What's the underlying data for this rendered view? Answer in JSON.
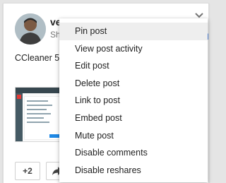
{
  "post": {
    "author": "ve",
    "sub_label": "Sh",
    "text": "CCleaner 5 fir",
    "side_link": "d"
  },
  "actions": {
    "plus_one_label": "+2"
  },
  "menu": {
    "items": [
      "Pin post",
      "View post activity",
      "Edit post",
      "Delete post",
      "Link to post",
      "Embed post",
      "Mute post",
      "Disable comments",
      "Disable reshares"
    ],
    "active_index": 0
  },
  "icons": {
    "avatar": "avatar",
    "menu": "chevron-down-icon",
    "share": "share-arrow-icon"
  }
}
